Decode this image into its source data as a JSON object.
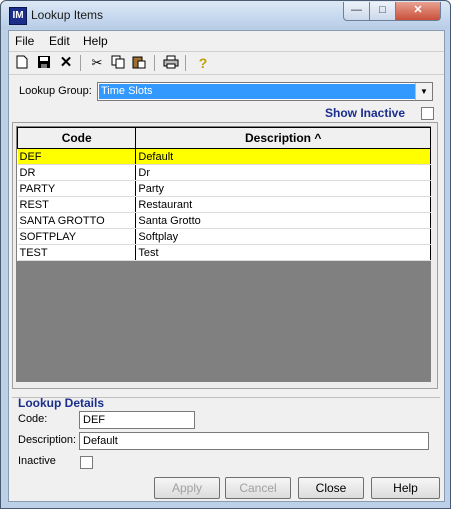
{
  "window": {
    "title": "Lookup Items"
  },
  "menu": [
    {
      "label": "File"
    },
    {
      "label": "Edit"
    },
    {
      "label": "Help"
    }
  ],
  "toolbar_icons": [
    "new-icon",
    "save-icon",
    "delete-icon",
    "cut-icon",
    "copy-icon",
    "paste-icon",
    "print-icon",
    "help-icon"
  ],
  "lookup_group": {
    "label": "Lookup Group:",
    "value": "Time Slots"
  },
  "show_inactive": {
    "label": "Show Inactive",
    "checked": false
  },
  "grid": {
    "headers": {
      "code": "Code",
      "description": "Description ^"
    },
    "selected_index": 0,
    "rows": [
      {
        "code": "DEF",
        "description": "Default"
      },
      {
        "code": "DR",
        "description": "Dr"
      },
      {
        "code": "PARTY",
        "description": "Party"
      },
      {
        "code": "REST",
        "description": "Restaurant"
      },
      {
        "code": "SANTA GROTTO",
        "description": "Santa Grotto"
      },
      {
        "code": "SOFTPLAY",
        "description": "Softplay"
      },
      {
        "code": "TEST",
        "description": "Test"
      }
    ]
  },
  "details": {
    "title": "Lookup Details",
    "code_label": "Code:",
    "code_value": "DEF",
    "description_label": "Description:",
    "description_value": "Default",
    "inactive_label": "Inactive"
  },
  "buttons": {
    "apply": "Apply",
    "cancel": "Cancel",
    "close": "Close",
    "help": "Help"
  }
}
